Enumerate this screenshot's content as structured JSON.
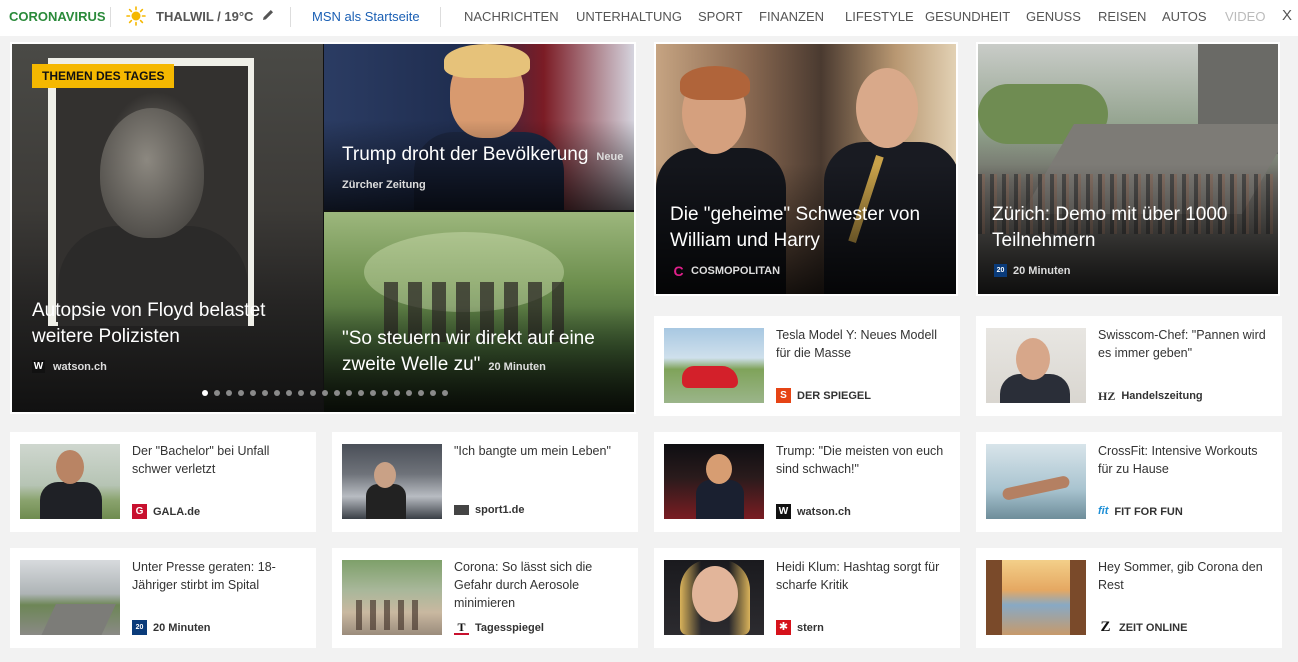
{
  "nav": {
    "corona": "CORONAVIRUS",
    "weather": "THALWIL / 19°C",
    "msn_start": "MSN als Startseite",
    "links": [
      "NACHRICHTEN",
      "UNTERHALTUNG",
      "SPORT",
      "FINANZEN",
      "LIFESTYLE",
      "GESUNDHEIT",
      "GENUSS",
      "REISEN",
      "AUTOS",
      "VIDEO"
    ],
    "close": "X"
  },
  "hero": {
    "badge": "THEMEN DES TAGES",
    "main_title": "Autopsie von Floyd belastet weitere Polizisten",
    "main_source": "watson.ch",
    "trump_title": "Trump droht der Bevölkerung",
    "trump_source": "Neue Zürcher Zeitung",
    "forest_title": "\"So steuern wir direkt auf eine zweite Welle zu\"",
    "forest_source": "20 Minuten",
    "dot_count": 21,
    "active_dot": 0
  },
  "big_cards": [
    {
      "title": "Die \"geheime\" Schwester von William und Harry",
      "source": "COSMOPOLITAN",
      "logo": "C"
    },
    {
      "title": "Zürich: Demo mit über 1000 Teilnehmern",
      "source": "20 Minuten",
      "logo": "20"
    }
  ],
  "cards": [
    {
      "headline": "Tesla Model Y: Neues Modell für die Masse",
      "source": "DER SPIEGEL",
      "logo": "S",
      "logo_color": "#e64415"
    },
    {
      "headline": "Swisscom-Chef: \"Pannen wird es immer geben\"",
      "source": "Handelszeitung",
      "logo": "HZ",
      "logo_color": "#333333"
    },
    {
      "headline": "Der \"Bachelor\" bei Unfall schwer verletzt",
      "source": "GALA.de",
      "logo": "G",
      "logo_color": "#c8102e"
    },
    {
      "headline": "\"Ich bangte um mein Leben\"",
      "source": "sport1.de",
      "logo": "",
      "logo_color": "#444444"
    },
    {
      "headline": "Trump: \"Die meisten von euch sind schwach!\"",
      "source": "watson.ch",
      "logo": "W",
      "logo_color": "#111111"
    },
    {
      "headline": "CrossFit: Intensive Workouts für zu Hause",
      "source": "FIT FOR FUN",
      "logo": "fit",
      "logo_color": "#1e8fd6"
    },
    {
      "headline": "Unter Presse geraten: 18-Jähriger stirbt im Spital",
      "source": "20 Minuten",
      "logo": "20",
      "logo_color": "#0a3b7a"
    },
    {
      "headline": "Corona: So lässt sich die Gefahr durch Aerosole minimieren",
      "source": "Tagesspiegel",
      "logo": "T",
      "logo_color": "#c8102e"
    },
    {
      "headline": "Heidi Klum: Hashtag sorgt für scharfe Kritik",
      "source": "stern",
      "logo": "✱",
      "logo_color": "#d6121b"
    },
    {
      "headline": "Hey Sommer, gib Corona den Rest",
      "source": "ZEIT ONLINE",
      "logo": "Z",
      "logo_color": "#111111"
    }
  ],
  "colors": {
    "corona_green": "#2a8a3a",
    "msn_blue": "#1a5fb4",
    "badge_yellow": "#f5b800",
    "page_bg": "#f2f2f2"
  },
  "icons": {
    "weather": "sun-icon",
    "edit": "pencil-icon",
    "close": "close-icon"
  }
}
